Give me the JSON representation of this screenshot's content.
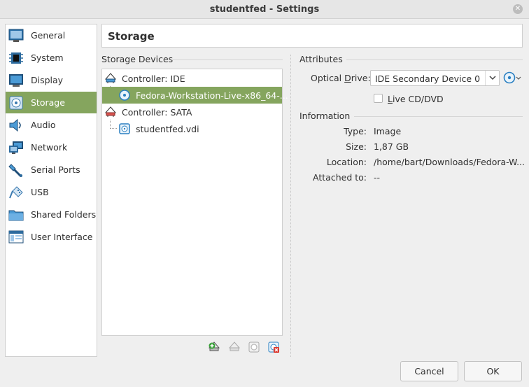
{
  "window": {
    "title": "studentfed - Settings"
  },
  "sidebar": {
    "items": [
      {
        "label": "General",
        "icon": "general-icon"
      },
      {
        "label": "System",
        "icon": "chip-icon"
      },
      {
        "label": "Display",
        "icon": "monitor-icon"
      },
      {
        "label": "Storage",
        "icon": "disk-icon",
        "selected": true
      },
      {
        "label": "Audio",
        "icon": "speaker-icon"
      },
      {
        "label": "Network",
        "icon": "network-icon"
      },
      {
        "label": "Serial Ports",
        "icon": "serial-port-icon"
      },
      {
        "label": "USB",
        "icon": "usb-icon"
      },
      {
        "label": "Shared Folders",
        "icon": "folder-icon"
      },
      {
        "label": "User Interface",
        "icon": "window-icon"
      }
    ]
  },
  "page": {
    "title": "Storage"
  },
  "storage_devices": {
    "label": "Storage Devices",
    "tree": [
      {
        "label": "Controller: IDE",
        "type": "controller",
        "icon": "ide-controller-icon"
      },
      {
        "label": "Fedora-Workstation-Live-x86_64-...",
        "type": "optical",
        "icon": "optical-disc-icon",
        "selected": true
      },
      {
        "label": "Controller: SATA",
        "type": "controller",
        "icon": "sata-controller-icon"
      },
      {
        "label": "studentfed.vdi",
        "type": "hdd",
        "icon": "hard-disk-icon"
      }
    ]
  },
  "attributes": {
    "label": "Attributes",
    "optical_drive_label_pre": "Optical ",
    "optical_drive_label_u": "D",
    "optical_drive_label_post": "rive:",
    "optical_drive_value": "IDE Secondary Device 0",
    "live_cd_label_u": "L",
    "live_cd_label_post": "ive CD/DVD",
    "live_cd_checked": false
  },
  "information": {
    "label": "Information",
    "type_label": "Type:",
    "type_value": "Image",
    "size_label": "Size:",
    "size_value": "1,87 GB",
    "location_label": "Location:",
    "location_value": "/home/bart/Downloads/Fedora-W...",
    "attached_label": "Attached to:",
    "attached_value": "--"
  },
  "buttons": {
    "cancel": "Cancel",
    "ok": "OK"
  },
  "colors": {
    "selection": "#85a55e",
    "accent_blue": "#2a7fc1"
  }
}
